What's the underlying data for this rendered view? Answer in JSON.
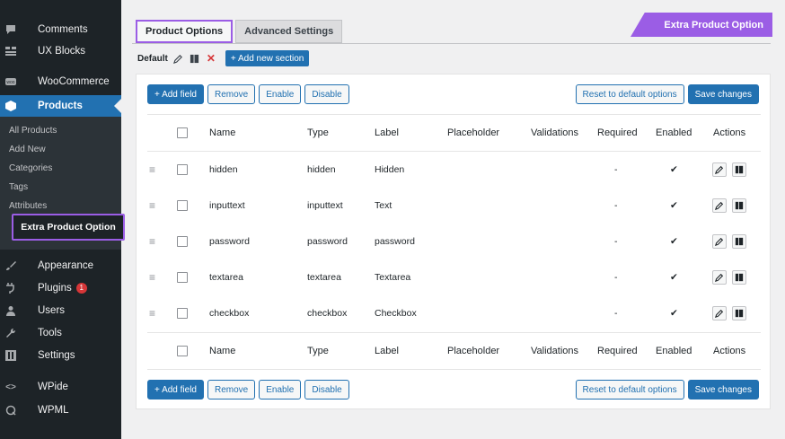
{
  "sidebar": {
    "items": [
      {
        "label": "Comments",
        "icon": "comment-icon"
      },
      {
        "label": "UX Blocks",
        "icon": "blocks-icon"
      },
      {
        "label": "WooCommerce",
        "icon": "woo-icon"
      },
      {
        "label": "Products",
        "icon": "box-icon"
      },
      {
        "label": "Appearance",
        "icon": "brush-icon"
      },
      {
        "label": "Plugins",
        "icon": "plug-icon",
        "badge": "1"
      },
      {
        "label": "Users",
        "icon": "user-icon"
      },
      {
        "label": "Tools",
        "icon": "wrench-icon"
      },
      {
        "label": "Settings",
        "icon": "settings-icon"
      },
      {
        "label": "WPide",
        "icon": "code-icon"
      },
      {
        "label": "WPML",
        "icon": "wpml-icon"
      }
    ],
    "submenu": [
      "All Products",
      "Add New",
      "Categories",
      "Tags",
      "Attributes"
    ],
    "submenu_highlight": "Extra Product Option"
  },
  "banner": "Extra Product Option",
  "tabs": [
    "Product Options",
    "Advanced Settings"
  ],
  "section": {
    "name": "Default",
    "add_label": "+ Add new section"
  },
  "buttons": {
    "add_field": "+ Add field",
    "remove": "Remove",
    "enable": "Enable",
    "disable": "Disable",
    "reset": "Reset to default options",
    "save": "Save changes"
  },
  "columns": [
    "Name",
    "Type",
    "Label",
    "Placeholder",
    "Validations",
    "Required",
    "Enabled",
    "Actions"
  ],
  "rows": [
    {
      "name": "hidden",
      "type": "hidden",
      "label": "Hidden",
      "placeholder": "",
      "validations": "",
      "required": "-",
      "enabled": "✔"
    },
    {
      "name": "inputtext",
      "type": "inputtext",
      "label": "Text",
      "placeholder": "",
      "validations": "",
      "required": "-",
      "enabled": "✔"
    },
    {
      "name": "password",
      "type": "password",
      "label": "password",
      "placeholder": "",
      "validations": "",
      "required": "-",
      "enabled": "✔"
    },
    {
      "name": "textarea",
      "type": "textarea",
      "label": "Textarea",
      "placeholder": "",
      "validations": "",
      "required": "-",
      "enabled": "✔"
    },
    {
      "name": "checkbox",
      "type": "checkbox",
      "label": "Checkbox",
      "placeholder": "",
      "validations": "",
      "required": "-",
      "enabled": "✔"
    }
  ],
  "colors": {
    "accent": "#9b5de5",
    "primary": "#2271b1",
    "sidebar_bg": "#1d2327"
  }
}
